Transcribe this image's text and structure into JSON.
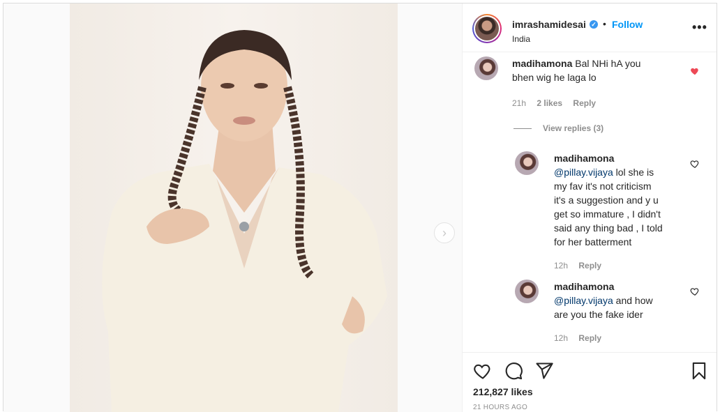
{
  "header": {
    "username": "imrashamidesai",
    "separator": "•",
    "follow_label": "Follow",
    "location": "India",
    "more_label": "•••",
    "verified_mark": "✓"
  },
  "media": {
    "next_arrow": "›"
  },
  "comments": [
    {
      "username": "madihamona",
      "text_line1": "Bal NHi hA you",
      "text_line2": "bhen wig he laga lo",
      "time": "21h",
      "likes": "2 likes",
      "reply_label": "Reply",
      "liked": true,
      "like_color": "#ed4956"
    },
    {
      "username": "madihamona",
      "mention": "@pillay.vijaya",
      "text_lines": [
        " lol she is",
        "my fav it's not criticism",
        "it's a suggestion and y u",
        "get so immature , I didn't",
        "said any thing bad , I told",
        "for her batterment"
      ],
      "time": "12h",
      "reply_label": "Reply"
    },
    {
      "username": "madihamona",
      "mention": "@pillay.vijaya",
      "text_lines": [
        " and how",
        "are you the fake ider"
      ],
      "time": "12h",
      "reply_label": "Reply"
    }
  ],
  "view_replies": "View replies (3)",
  "actions": {
    "likes_count": "212,827 likes",
    "time_ago": "21 HOURS AGO"
  },
  "colors": {
    "accent": "#0095f6",
    "muted": "#8e8e8e",
    "text": "#262626"
  }
}
